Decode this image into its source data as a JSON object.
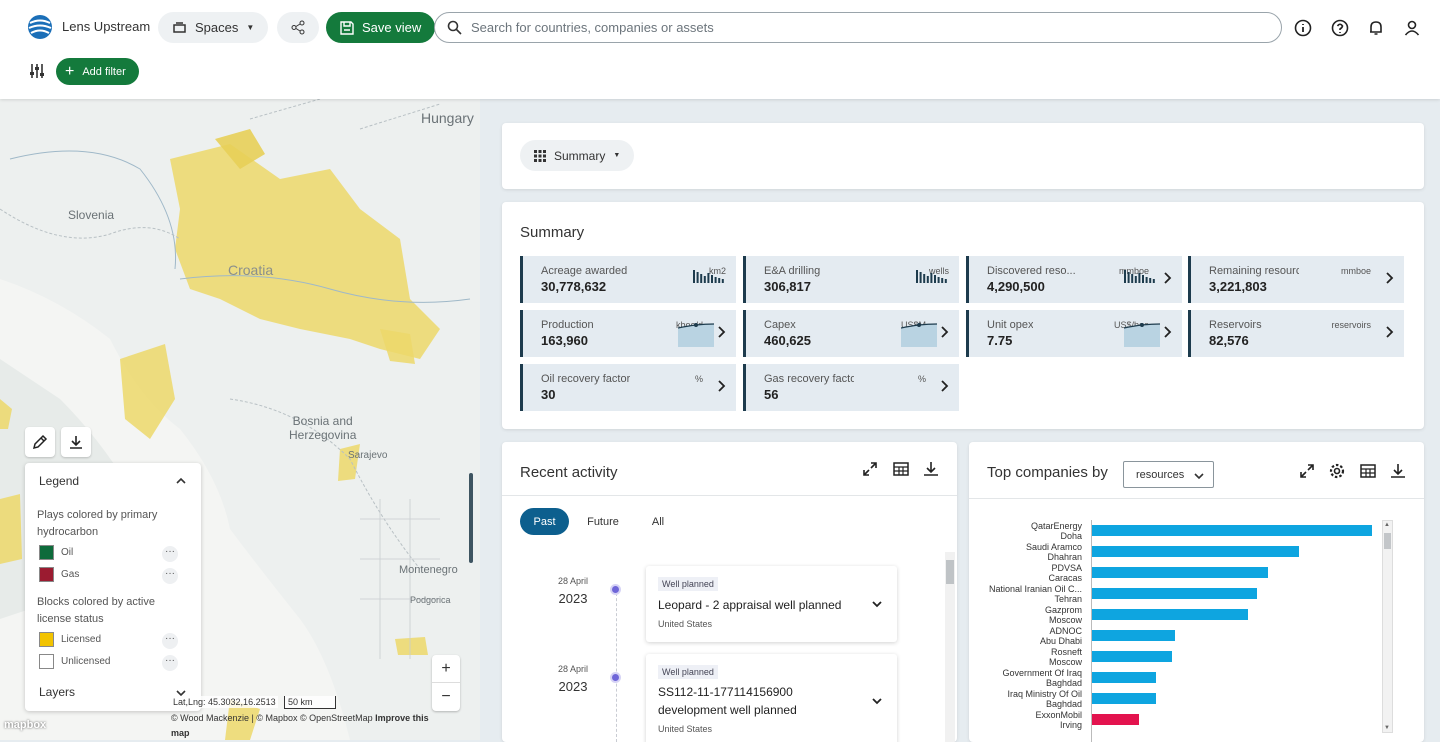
{
  "app": {
    "name": "Lens Upstream"
  },
  "header": {
    "spaces_label": "Spaces",
    "save_view_label": "Save view",
    "search_placeholder": "Search for countries, companies or assets",
    "add_filter_label": "Add filter"
  },
  "map": {
    "labels": [
      "Hungary",
      "Slovenia",
      "Croatia",
      "Bosnia and\nHerzegovina",
      "Sarajevo",
      "Montenegro",
      "Podgorica"
    ],
    "legend": {
      "title": "Legend",
      "plays_heading": "Plays colored by primary hydrocarbon",
      "plays": [
        {
          "label": "Oil",
          "color": "#0d6b3b"
        },
        {
          "label": "Gas",
          "color": "#9b1b30"
        }
      ],
      "blocks_heading": "Blocks colored by active license status",
      "blocks": [
        {
          "label": "Licensed",
          "color": "#f2c300"
        },
        {
          "label": "Unlicensed",
          "color": "#ffffff"
        }
      ],
      "layers_label": "Layers",
      "more_symbol": "···"
    },
    "zoom_in": "+",
    "zoom_out": "−",
    "coords": "Lat,Lng: 45.3032,16.2513",
    "scale": "50 km",
    "attribution": "© Wood Mackenzie | © Mapbox © OpenStreetMap",
    "improve": "Improve this map",
    "mapbox": "mapbox"
  },
  "summary_selector": {
    "label": "Summary"
  },
  "summary": {
    "title": "Summary",
    "tiles": [
      {
        "label": "Acreage awarded",
        "unit": "km2",
        "value": "30,778,632",
        "spark": "bars",
        "chev": false
      },
      {
        "label": "E&A drilling",
        "unit": "wells",
        "value": "306,817",
        "spark": "bars",
        "chev": false
      },
      {
        "label": "Discovered reso...",
        "unit": "mmboe",
        "value": "4,290,500",
        "spark": "bars",
        "chev": true
      },
      {
        "label": "Remaining resources",
        "unit": "mmboe",
        "value": "3,221,803",
        "spark": "",
        "chev": true
      },
      {
        "label": "Production",
        "unit": "kboe/d",
        "value": "163,960",
        "spark": "area",
        "chev": true
      },
      {
        "label": "Capex",
        "unit": "US$M",
        "value": "460,625",
        "spark": "area",
        "chev": true
      },
      {
        "label": "Unit opex",
        "unit": "US$/boe",
        "value": "7.75",
        "spark": "area",
        "chev": true
      },
      {
        "label": "Reservoirs",
        "unit": "reservoirs",
        "value": "82,576",
        "spark": "",
        "chev": true
      },
      {
        "label": "Oil recovery factor",
        "unit": "%",
        "value": "30",
        "spark": "",
        "chev": true
      },
      {
        "label": "Gas recovery factor",
        "unit": "%",
        "value": "56",
        "spark": "",
        "chev": true
      }
    ]
  },
  "recent_activity": {
    "title": "Recent activity",
    "tabs": [
      "Past",
      "Future",
      "All"
    ],
    "items": [
      {
        "day": "28 April",
        "year": "2023",
        "tag": "Well planned",
        "title": "Leopard - 2 appraisal well planned",
        "location": "United States"
      },
      {
        "day": "28 April",
        "year": "2023",
        "tag": "Well planned",
        "title": "SS112-11-177114156900 development well planned",
        "location": "United States"
      }
    ]
  },
  "top_companies": {
    "title": "Top companies by",
    "metric": "resources"
  },
  "chart_data": {
    "type": "bar",
    "orientation": "horizontal",
    "categories": [
      "QatarEnergy\nDoha",
      "Saudi Aramco\nDhahran",
      "PDVSA\nCaracas",
      "National Iranian Oil C...\nTehran",
      "Gazprom\nMoscow",
      "ADNOC\nAbu Dhabi",
      "Rosneft\nMoscow",
      "Government Of Iraq\nBaghdad",
      "Iraq Ministry Of Oil\nBaghdad",
      "ExxonMobil\nIrving"
    ],
    "values": [
      100,
      74,
      63,
      59,
      56,
      30,
      29,
      23,
      23,
      17
    ],
    "colors": [
      "#0ea5e0",
      "#0ea5e0",
      "#0ea5e0",
      "#0ea5e0",
      "#0ea5e0",
      "#0ea5e0",
      "#0ea5e0",
      "#0ea5e0",
      "#0ea5e0",
      "#e3134e"
    ],
    "xlim": [
      0,
      100
    ]
  }
}
